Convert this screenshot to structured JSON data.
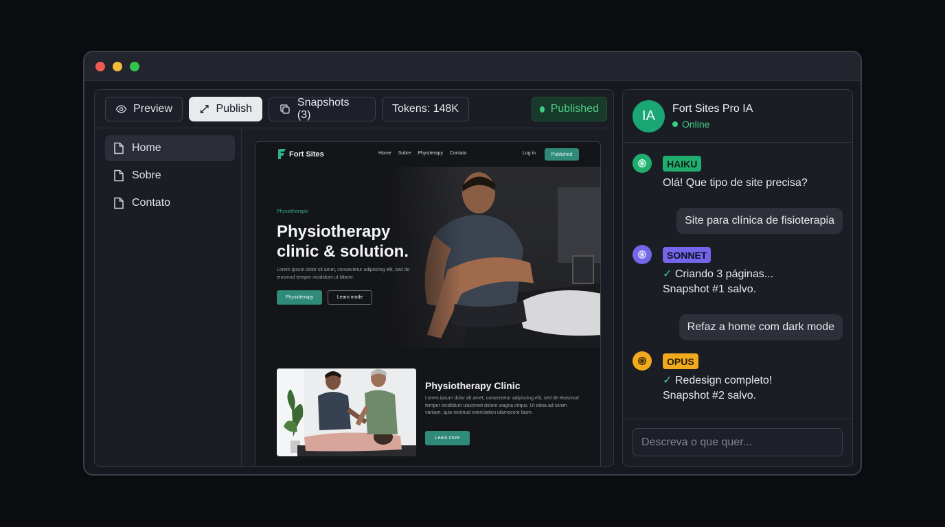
{
  "toolbar": {
    "preview_label": "Preview",
    "publish_label": "Publish",
    "snapshots_label": "Snapshots (3)",
    "tokens_label": "Tokens: 148K",
    "status_label": "Published"
  },
  "sidebar": {
    "items": [
      {
        "label": "Home",
        "active": true
      },
      {
        "label": "Sobre",
        "active": false
      },
      {
        "label": "Contato",
        "active": false
      }
    ]
  },
  "site": {
    "logo": "Fort Sites",
    "nav_links": [
      "Home",
      "Sobre",
      "Physiterapy",
      "Contato"
    ],
    "login": "Log in",
    "published": "Published",
    "kicker": "Physiotherapic",
    "headline": "Physiotherapy clinic & solution.",
    "body": "Lorem ipsum dolor sit amet, consectetur adipiscing elit, sed do eiusmod tempor incididunt ut labore.",
    "primary_btn": "Physioterapy",
    "secondary_btn": "Learn mode",
    "section_title": "Physiotherapy Clinic",
    "section_body": "Lorem ipsum dolor alt amet, consectetur adipiscing elit, sed de eluismod temper incididunt ulacoreet dolore wagna cirqus. Ut edna ad ivinim vaniam, quis nestnud exerciiaticn ulamocore laom.",
    "section_btn": "Learn more"
  },
  "chat": {
    "avatar_initials": "IA",
    "bot_name": "Fort Sites Pro IA",
    "status": "Online",
    "messages": [
      {
        "model": "HAIKU",
        "text": "Olá! Que tipo de site precisa?"
      },
      {
        "user": "Site para clínica de fisioterapia"
      },
      {
        "model": "SONNET",
        "line1": "Criando 3 páginas...",
        "line2": "Snapshot #1 salvo."
      },
      {
        "user": "Refaz a home com dark mode"
      },
      {
        "model": "OPUS",
        "line1": "Redesign completo!",
        "line2": "Snapshot #2 salvo."
      }
    ],
    "input_placeholder": "Descreva o que quer..."
  },
  "colors": {
    "accent_green": "#3fcf83",
    "haiku": "#1fae6e",
    "sonnet": "#7466e8",
    "opus": "#f1a91d",
    "site_teal": "#2f8a79"
  },
  "icons": [
    "eye-icon",
    "expand-arrow-icon",
    "copy-icon",
    "file-icon",
    "openai-knot-icon",
    "check-icon"
  ]
}
